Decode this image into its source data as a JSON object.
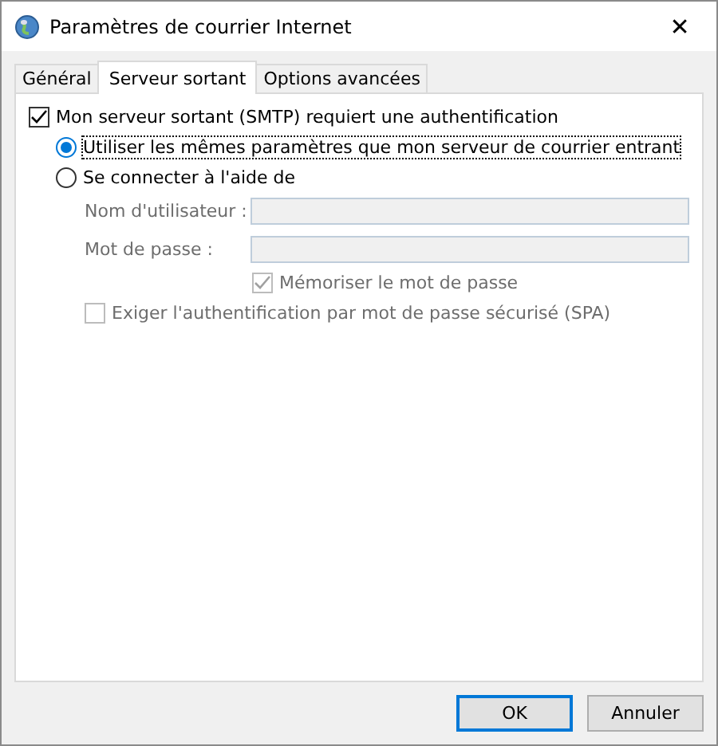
{
  "window": {
    "title": "Paramètres de courrier Internet",
    "close": "✕"
  },
  "tabs": [
    {
      "label": "Général",
      "selected": false
    },
    {
      "label": "Serveur sortant",
      "selected": true
    },
    {
      "label": "Options avancées",
      "selected": false
    }
  ],
  "auth": {
    "label": "Mon serveur sortant (SMTP) requiert une authentification",
    "checked": true
  },
  "options": [
    {
      "label": "Utiliser les mêmes paramètres que mon serveur de courrier entrant",
      "selected": true,
      "focused": true
    },
    {
      "label": "Se connecter à l'aide de",
      "selected": false,
      "focused": false
    }
  ],
  "fields": [
    {
      "label": "Nom d'utilisateur :",
      "disabled": true
    },
    {
      "label": "Mot de passe :",
      "disabled": true
    }
  ],
  "remember": {
    "label": "Mémoriser le mot de passe",
    "checked": true,
    "disabled": true
  },
  "spa": {
    "label": "Exiger l'authentification par mot de passe sécurisé (SPA)",
    "checked": false,
    "disabled": true
  },
  "buttons": [
    {
      "label": "OK",
      "default": true
    },
    {
      "label": "Annuler",
      "default": false
    }
  ]
}
